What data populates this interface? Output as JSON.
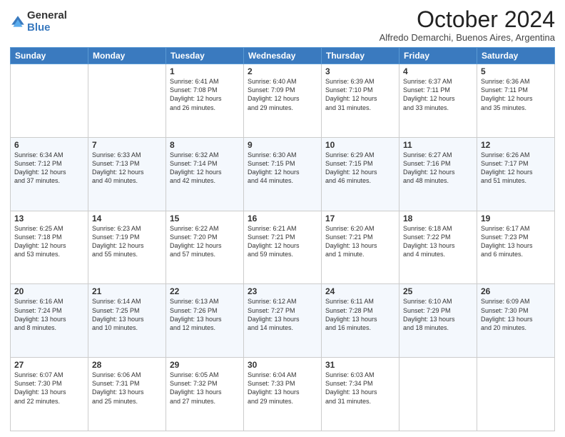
{
  "logo": {
    "general": "General",
    "blue": "Blue"
  },
  "header": {
    "title": "October 2024",
    "subtitle": "Alfredo Demarchi, Buenos Aires, Argentina"
  },
  "days_of_week": [
    "Sunday",
    "Monday",
    "Tuesday",
    "Wednesday",
    "Thursday",
    "Friday",
    "Saturday"
  ],
  "weeks": [
    [
      {
        "day": "",
        "info": ""
      },
      {
        "day": "",
        "info": ""
      },
      {
        "day": "1",
        "info": "Sunrise: 6:41 AM\nSunset: 7:08 PM\nDaylight: 12 hours\nand 26 minutes."
      },
      {
        "day": "2",
        "info": "Sunrise: 6:40 AM\nSunset: 7:09 PM\nDaylight: 12 hours\nand 29 minutes."
      },
      {
        "day": "3",
        "info": "Sunrise: 6:39 AM\nSunset: 7:10 PM\nDaylight: 12 hours\nand 31 minutes."
      },
      {
        "day": "4",
        "info": "Sunrise: 6:37 AM\nSunset: 7:11 PM\nDaylight: 12 hours\nand 33 minutes."
      },
      {
        "day": "5",
        "info": "Sunrise: 6:36 AM\nSunset: 7:11 PM\nDaylight: 12 hours\nand 35 minutes."
      }
    ],
    [
      {
        "day": "6",
        "info": "Sunrise: 6:34 AM\nSunset: 7:12 PM\nDaylight: 12 hours\nand 37 minutes."
      },
      {
        "day": "7",
        "info": "Sunrise: 6:33 AM\nSunset: 7:13 PM\nDaylight: 12 hours\nand 40 minutes."
      },
      {
        "day": "8",
        "info": "Sunrise: 6:32 AM\nSunset: 7:14 PM\nDaylight: 12 hours\nand 42 minutes."
      },
      {
        "day": "9",
        "info": "Sunrise: 6:30 AM\nSunset: 7:15 PM\nDaylight: 12 hours\nand 44 minutes."
      },
      {
        "day": "10",
        "info": "Sunrise: 6:29 AM\nSunset: 7:15 PM\nDaylight: 12 hours\nand 46 minutes."
      },
      {
        "day": "11",
        "info": "Sunrise: 6:27 AM\nSunset: 7:16 PM\nDaylight: 12 hours\nand 48 minutes."
      },
      {
        "day": "12",
        "info": "Sunrise: 6:26 AM\nSunset: 7:17 PM\nDaylight: 12 hours\nand 51 minutes."
      }
    ],
    [
      {
        "day": "13",
        "info": "Sunrise: 6:25 AM\nSunset: 7:18 PM\nDaylight: 12 hours\nand 53 minutes."
      },
      {
        "day": "14",
        "info": "Sunrise: 6:23 AM\nSunset: 7:19 PM\nDaylight: 12 hours\nand 55 minutes."
      },
      {
        "day": "15",
        "info": "Sunrise: 6:22 AM\nSunset: 7:20 PM\nDaylight: 12 hours\nand 57 minutes."
      },
      {
        "day": "16",
        "info": "Sunrise: 6:21 AM\nSunset: 7:21 PM\nDaylight: 12 hours\nand 59 minutes."
      },
      {
        "day": "17",
        "info": "Sunrise: 6:20 AM\nSunset: 7:21 PM\nDaylight: 13 hours\nand 1 minute."
      },
      {
        "day": "18",
        "info": "Sunrise: 6:18 AM\nSunset: 7:22 PM\nDaylight: 13 hours\nand 4 minutes."
      },
      {
        "day": "19",
        "info": "Sunrise: 6:17 AM\nSunset: 7:23 PM\nDaylight: 13 hours\nand 6 minutes."
      }
    ],
    [
      {
        "day": "20",
        "info": "Sunrise: 6:16 AM\nSunset: 7:24 PM\nDaylight: 13 hours\nand 8 minutes."
      },
      {
        "day": "21",
        "info": "Sunrise: 6:14 AM\nSunset: 7:25 PM\nDaylight: 13 hours\nand 10 minutes."
      },
      {
        "day": "22",
        "info": "Sunrise: 6:13 AM\nSunset: 7:26 PM\nDaylight: 13 hours\nand 12 minutes."
      },
      {
        "day": "23",
        "info": "Sunrise: 6:12 AM\nSunset: 7:27 PM\nDaylight: 13 hours\nand 14 minutes."
      },
      {
        "day": "24",
        "info": "Sunrise: 6:11 AM\nSunset: 7:28 PM\nDaylight: 13 hours\nand 16 minutes."
      },
      {
        "day": "25",
        "info": "Sunrise: 6:10 AM\nSunset: 7:29 PM\nDaylight: 13 hours\nand 18 minutes."
      },
      {
        "day": "26",
        "info": "Sunrise: 6:09 AM\nSunset: 7:30 PM\nDaylight: 13 hours\nand 20 minutes."
      }
    ],
    [
      {
        "day": "27",
        "info": "Sunrise: 6:07 AM\nSunset: 7:30 PM\nDaylight: 13 hours\nand 22 minutes."
      },
      {
        "day": "28",
        "info": "Sunrise: 6:06 AM\nSunset: 7:31 PM\nDaylight: 13 hours\nand 25 minutes."
      },
      {
        "day": "29",
        "info": "Sunrise: 6:05 AM\nSunset: 7:32 PM\nDaylight: 13 hours\nand 27 minutes."
      },
      {
        "day": "30",
        "info": "Sunrise: 6:04 AM\nSunset: 7:33 PM\nDaylight: 13 hours\nand 29 minutes."
      },
      {
        "day": "31",
        "info": "Sunrise: 6:03 AM\nSunset: 7:34 PM\nDaylight: 13 hours\nand 31 minutes."
      },
      {
        "day": "",
        "info": ""
      },
      {
        "day": "",
        "info": ""
      }
    ]
  ]
}
